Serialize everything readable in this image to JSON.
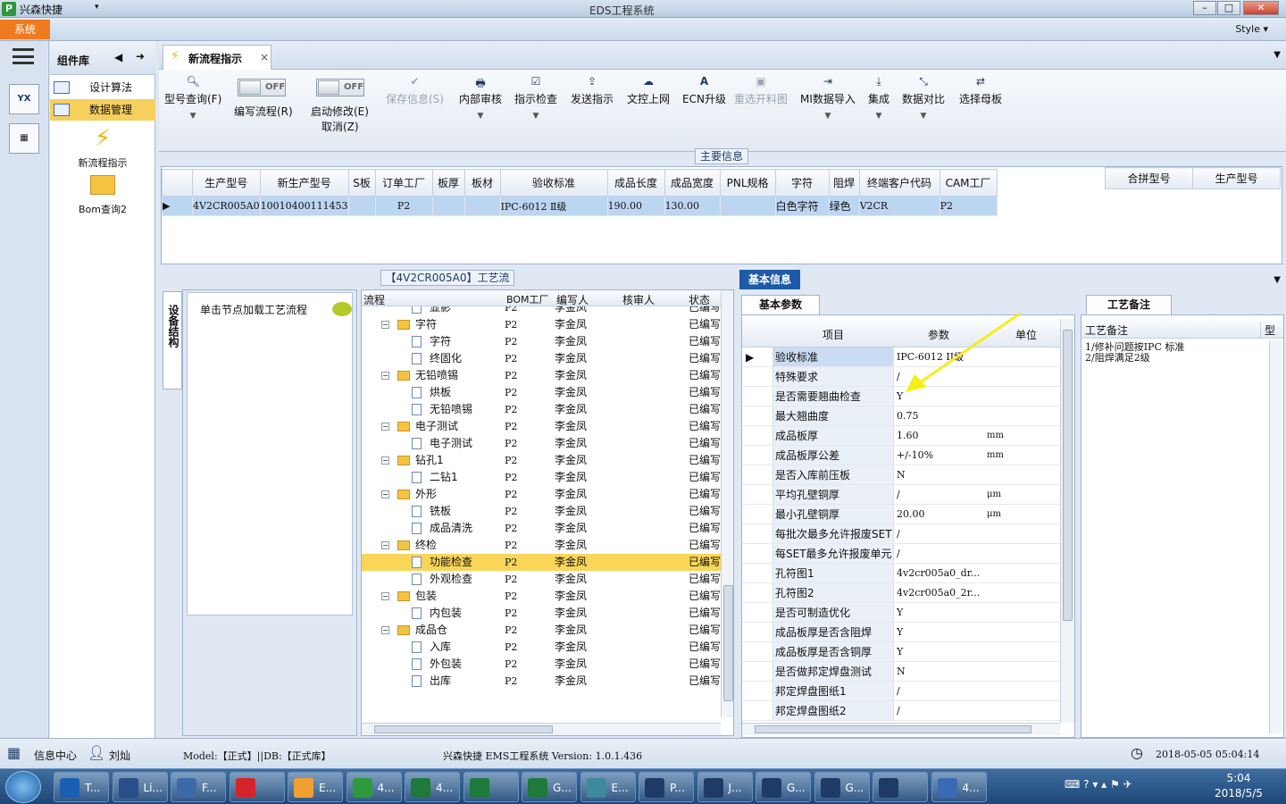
{
  "titlebar": {
    "app_name": "兴森快捷",
    "window_title": "EDS工程系统",
    "style_label": "Style"
  },
  "system_tab": "系统",
  "components": {
    "title": "组件库",
    "items": [
      {
        "label": "设计算法"
      },
      {
        "label": "数据管理"
      }
    ],
    "big_items": [
      {
        "label": "新流程指示"
      },
      {
        "label": "Bom查询2"
      }
    ]
  },
  "tab": {
    "label": "新流程指示",
    "close": "×"
  },
  "ribbon": {
    "model_query": "型号查询(F)",
    "edit_flow": "编写流程(R)",
    "start_modify": "启动修改(E)",
    "cancel": "取消(Z)",
    "toggle_off": "OFF",
    "save_info": "保存信息(S)",
    "internal_review": "内部审核",
    "instruction_check": "指示检查",
    "send_instruction": "发送指示",
    "doc_upload": "文控上网",
    "ecn_upgrade": "ECN升级",
    "reselect_material": "重选开料图",
    "mi_import": "MI数据导入",
    "integrate": "集成",
    "data_compare": "数据对比",
    "select_mother": "选择母板"
  },
  "main_info": {
    "title": "主要信息",
    "columns": [
      "生产型号",
      "新生产型号",
      "S板",
      "订单工厂",
      "板厚",
      "板材",
      "验收标准",
      "成品长度",
      "成品宽度",
      "PNL规格",
      "字符",
      "阻焊",
      "终端客户代码",
      "CAM工厂"
    ],
    "row": [
      "4V2CR005A0",
      "10010400111453",
      "",
      "P2",
      "",
      "",
      "IPC-6012 Ⅱ级",
      "190.00",
      "130.00",
      "",
      "白色字符",
      "绿色",
      "V2CR",
      "P2"
    ],
    "right_columns": [
      "合拼型号",
      "生产型号"
    ]
  },
  "process": {
    "title": "【4V2CR005A0】工艺流程",
    "side_tab": "设备结构",
    "hint": "单击节点加载工艺流程",
    "columns": [
      "流程",
      "BOM工厂",
      "编写人",
      "核审人",
      "状态"
    ],
    "rows": [
      {
        "name": "显影",
        "level": 2,
        "bom": "P2",
        "writer": "李金凤",
        "status": "已编写"
      },
      {
        "name": "字符",
        "level": 1,
        "bom": "P2",
        "writer": "李金凤",
        "status": "已编写"
      },
      {
        "name": "字符",
        "level": 2,
        "bom": "P2",
        "writer": "李金凤",
        "status": "已编写"
      },
      {
        "name": "终固化",
        "level": 2,
        "bom": "P2",
        "writer": "李金凤",
        "status": "已编写"
      },
      {
        "name": "无铅喷锡",
        "level": 1,
        "bom": "P2",
        "writer": "李金凤",
        "status": "已编写"
      },
      {
        "name": "烘板",
        "level": 2,
        "bom": "P2",
        "writer": "李金凤",
        "status": "已编写"
      },
      {
        "name": "无铅喷锡",
        "level": 2,
        "bom": "P2",
        "writer": "李金凤",
        "status": "已编写"
      },
      {
        "name": "电子测试",
        "level": 1,
        "bom": "P2",
        "writer": "李金凤",
        "status": "已编写"
      },
      {
        "name": "电子测试",
        "level": 2,
        "bom": "P2",
        "writer": "李金凤",
        "status": "已编写"
      },
      {
        "name": "钻孔1",
        "level": 1,
        "bom": "P2",
        "writer": "李金凤",
        "status": "已编写"
      },
      {
        "name": "二钻1",
        "level": 2,
        "bom": "P2",
        "writer": "李金凤",
        "status": "已编写"
      },
      {
        "name": "外形",
        "level": 1,
        "bom": "P2",
        "writer": "李金凤",
        "status": "已编写"
      },
      {
        "name": "铣板",
        "level": 2,
        "bom": "P2",
        "writer": "李金凤",
        "status": "已编写"
      },
      {
        "name": "成品清洗",
        "level": 2,
        "bom": "P2",
        "writer": "李金凤",
        "status": "已编写"
      },
      {
        "name": "终检",
        "level": 1,
        "bom": "P2",
        "writer": "李金凤",
        "status": "已编写"
      },
      {
        "name": "功能检查",
        "level": 2,
        "bom": "P2",
        "writer": "李金凤",
        "status": "已编写",
        "selected": true
      },
      {
        "name": "外观检查",
        "level": 2,
        "bom": "P2",
        "writer": "李金凤",
        "status": "已编写"
      },
      {
        "name": "包装",
        "level": 1,
        "bom": "P2",
        "writer": "李金凤",
        "status": "已编写"
      },
      {
        "name": "内包装",
        "level": 2,
        "bom": "P2",
        "writer": "李金凤",
        "status": "已编写"
      },
      {
        "name": "成品仓",
        "level": 1,
        "bom": "P2",
        "writer": "李金凤",
        "status": "已编写"
      },
      {
        "name": "入库",
        "level": 2,
        "bom": "P2",
        "writer": "李金凤",
        "status": "已编写"
      },
      {
        "name": "外包装",
        "level": 2,
        "bom": "P2",
        "writer": "李金凤",
        "status": "已编写"
      },
      {
        "name": "出库",
        "level": 2,
        "bom": "P2",
        "writer": "李金凤",
        "status": "已编写"
      }
    ]
  },
  "basic_info": {
    "title": "基本信息",
    "subtab": "基本参数",
    "columns": [
      "项目",
      "参数",
      "单位"
    ],
    "rows": [
      {
        "k": "验收标准",
        "v": "IPC-6012 II级",
        "u": "",
        "sel": true
      },
      {
        "k": "特殊要求",
        "v": "/",
        "u": ""
      },
      {
        "k": "是否需要翘曲检查",
        "v": "Y",
        "u": ""
      },
      {
        "k": "最大翘曲度",
        "v": "0.75",
        "u": ""
      },
      {
        "k": "成品板厚",
        "v": "1.60",
        "u": "mm"
      },
      {
        "k": "成品板厚公差",
        "v": "+/-10%",
        "u": "mm"
      },
      {
        "k": "是否入库前压板",
        "v": "N",
        "u": ""
      },
      {
        "k": "平均孔壁铜厚",
        "v": "/",
        "u": "μm"
      },
      {
        "k": "最小孔壁铜厚",
        "v": "20.00",
        "u": "μm"
      },
      {
        "k": "每批次最多允许报废SET",
        "v": "/",
        "u": ""
      },
      {
        "k": "每SET最多允许报废单元",
        "v": "/",
        "u": ""
      },
      {
        "k": "孔符图1",
        "v": "4v2cr005a0_dr...",
        "u": ""
      },
      {
        "k": "孔符图2",
        "v": "4v2cr005a0_2r...",
        "u": ""
      },
      {
        "k": "是否可制造优化",
        "v": "Y",
        "u": ""
      },
      {
        "k": "成品板厚是否含阻焊",
        "v": "Y",
        "u": ""
      },
      {
        "k": "成品板厚是否含铜厚",
        "v": "Y",
        "u": ""
      },
      {
        "k": "是否做邦定焊盘测试",
        "v": "N",
        "u": ""
      },
      {
        "k": "邦定焊盘图纸1",
        "v": "/",
        "u": ""
      },
      {
        "k": "邦定焊盘图纸2",
        "v": "/",
        "u": ""
      }
    ]
  },
  "craft_notes": {
    "tab": "工艺备注",
    "column": "工艺备注",
    "col2": "型",
    "text1": "1/修补问题按IPC 标准",
    "text2": "2/阻焊满足2级"
  },
  "status": {
    "info_center": "信息中心",
    "user": "刘灿",
    "model": "Model:【正式】||DB:【正式库】",
    "system": "兴森快捷 EMS工程系统 Version: 1.0.1.436",
    "datetime": "2018-05-05 05:04:14"
  },
  "taskbar": {
    "time": "5:04",
    "date": "2018/5/5",
    "items": [
      "T...",
      "Li...",
      "F...",
      "",
      "E...",
      "4...",
      "4...",
      "",
      "G...",
      "E...",
      "P...",
      "J...",
      "G...",
      "G...",
      "",
      "4..."
    ]
  }
}
